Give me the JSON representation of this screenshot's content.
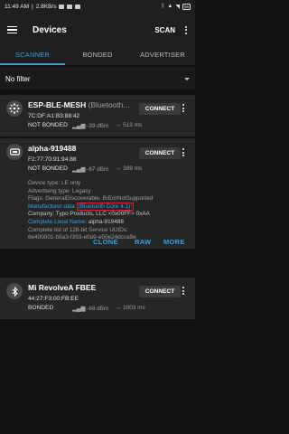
{
  "statusbar": {
    "time": "11:49 AM",
    "speed": "2.8KB/s",
    "battery": "56"
  },
  "appbar": {
    "title": "Devices",
    "scan_label": "SCAN"
  },
  "tabs": [
    {
      "label": "SCANNER",
      "active": true
    },
    {
      "label": "BONDED",
      "active": false
    },
    {
      "label": "ADVERTISER",
      "active": false
    }
  ],
  "filter": {
    "label": "No filter"
  },
  "devices": [
    {
      "name": "ESP-BLE-MESH",
      "subtitle": "(Bluetooth...",
      "mac": "7C:DF:A1:B3:88:42",
      "bond": "NOT BONDED",
      "rssi": "-39 dBm",
      "interval": "↔ 513 ms",
      "connect": "CONNECT",
      "icon": "mesh-icon"
    },
    {
      "name": "alpha-919488",
      "mac": "F2:77:70:91:94:88",
      "bond": "NOT BONDED",
      "rssi": "-67 dBm",
      "interval": "↔ 389 ms",
      "connect": "CONNECT",
      "icon": "beacon-icon",
      "details": {
        "device_type": "Device type: LE only",
        "adv_type": "Advertising type: Legacy",
        "flags": "Flags: GeneralDiscoverable, BrEdrNotSupported",
        "manufacturer_label": "Manufacturer data",
        "manufacturer_note": "(Bluetooth Core 4.1):",
        "company": "Company: Typo Products, LLC <0x00FF> 0xAA",
        "local_name": "Complete Local Name: alpha-919488",
        "uuids_label": "Complete list of 128-bit Service UUIDs:",
        "uuids_value": "6e400001-b5a3-f393-e0a9-e50e24dcca9e"
      },
      "actions": [
        "CLONE",
        "RAW",
        "MORE"
      ]
    },
    {
      "name": "Mi RevolveA FBEE",
      "mac": "44:27:F3:00:FB:EE",
      "bond": "BONDED",
      "rssi": "-88 dBm",
      "interval": "↔ 1003 ms",
      "connect": "CONNECT",
      "icon": "bluetooth-icon"
    }
  ],
  "colors": {
    "accent": "#2fa4e6",
    "background": "#121212",
    "card": "#262626",
    "highlight_box": "#d4242d"
  }
}
